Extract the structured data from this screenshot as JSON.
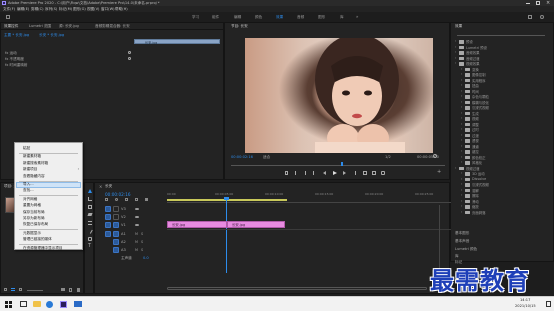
{
  "titlebar": {
    "title": "Adobe Premiere Pro 2020 - C:\\用户\\Fiqw\\文档\\Adobe\\Premiere Pro\\14.0\\未命名.prproj *",
    "app_icon": "premiere-pro-icon"
  },
  "menubar": {
    "items": [
      "文件(F)",
      "编辑(E)",
      "剪辑(C)",
      "序列(S)",
      "标记(M)",
      "图形(G)",
      "视图(V)",
      "窗口(W)",
      "帮助(H)"
    ]
  },
  "workspaces": {
    "items": [
      "学习",
      "组件",
      "编辑",
      "颜色",
      "效果",
      "音频",
      "图形",
      "库"
    ],
    "active_index": 4
  },
  "source_panel": {
    "tabs": [
      "效果控件",
      "Lumetri 范围",
      "源: 长安.jpg",
      "音频剪辑混合器: 长安"
    ],
    "header_left": "主要 * 长安.jpg",
    "header_right": "长安 * 长安.jpg",
    "sections": [
      "fx 运动",
      "fx 不透明度",
      "fx 时间重映射"
    ],
    "clip_label": "长安.jpg"
  },
  "program_monitor": {
    "tab": "节目: 长安",
    "timecode_left": "00:00:02:16",
    "fit_label": "适合",
    "quality_label": "1/2",
    "timecode_right": "00:00:05:00"
  },
  "effects_panel": {
    "tab": "效果",
    "tree": [
      "预设",
      "Lumetri 预设",
      "音频效果",
      "音频过渡",
      "视频效果",
      "变换",
      "图像控制",
      "实用程序",
      "扭曲",
      "时间",
      "杂色与颗粒",
      "模糊与锐化",
      "沉浸式视频",
      "生成",
      "视频",
      "调整",
      "过时",
      "过渡",
      "透视",
      "通道",
      "键控",
      "颜色校正",
      "风格化",
      "视频过渡",
      "3D 运动",
      "Dissolve",
      "沉浸式视频",
      "溶解",
      "擦除",
      "滑动",
      "缩放",
      "页面剥落"
    ],
    "bottom_items": [
      "基本图形",
      "基本声音",
      "Lumetri 颜色",
      "库",
      "标记"
    ]
  },
  "project_panel": {
    "tab": "项目: 未命名"
  },
  "context_menu": {
    "items": [
      "粘贴",
      "新建素材箱",
      "新建搜索素材箱",
      "新建项目",
      "查看隐藏内容",
      "导入...",
      "查找...",
      "对齐网格",
      "重置为网格",
      "保存当前布局",
      "另存为新布局",
      "恢复已保存布局",
      "元数据显示",
      "管理已链接的媒体",
      "在资源管理器中显示项目"
    ],
    "highlighted_index": 5,
    "submenu_indices": [
      3
    ]
  },
  "timeline": {
    "tab": "长安",
    "timecode": "00:00:02:16",
    "ruler_labels": [
      "00:00",
      "00:00:05:00",
      "00:00:10:00",
      "00:00:15:00",
      "00:00:20:00",
      "00:00:25:00"
    ],
    "video_tracks": [
      "V3",
      "V2",
      "V1"
    ],
    "audio_tracks": [
      "A1",
      "A2",
      "A3"
    ],
    "master_label": "主声道",
    "master_value": "0.0",
    "clips": [
      {
        "label": "长安.jpg",
        "track": "V1"
      },
      {
        "label": "长安.jpg",
        "track": "V1"
      }
    ]
  },
  "taskbar": {
    "time": "14:17",
    "date": "2021/10/15"
  },
  "watermark": {
    "text": "最需教育"
  }
}
